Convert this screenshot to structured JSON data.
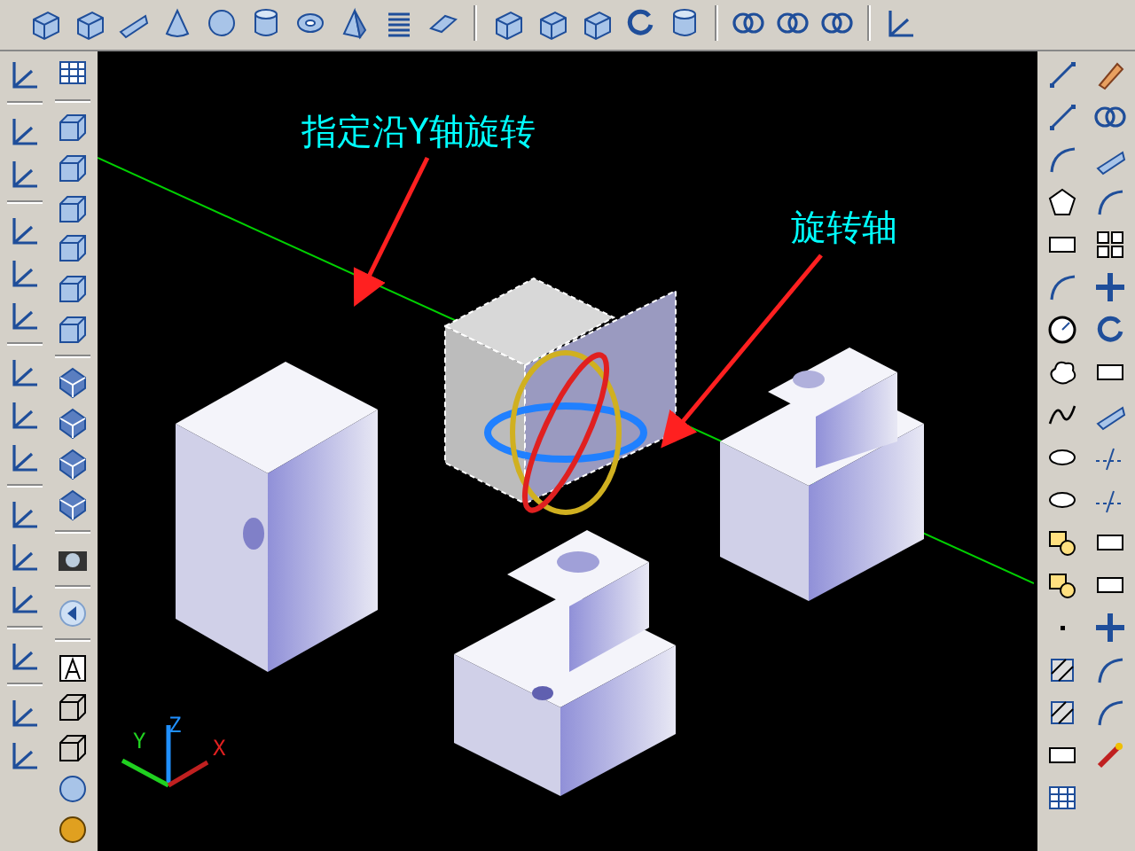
{
  "annotations": [
    {
      "text": "指定沿Y轴旋转"
    },
    {
      "text": "旋转轴"
    }
  ],
  "ucs_axes": [
    {
      "label": "X"
    },
    {
      "label": "Y"
    },
    {
      "label": "Z"
    }
  ]
}
